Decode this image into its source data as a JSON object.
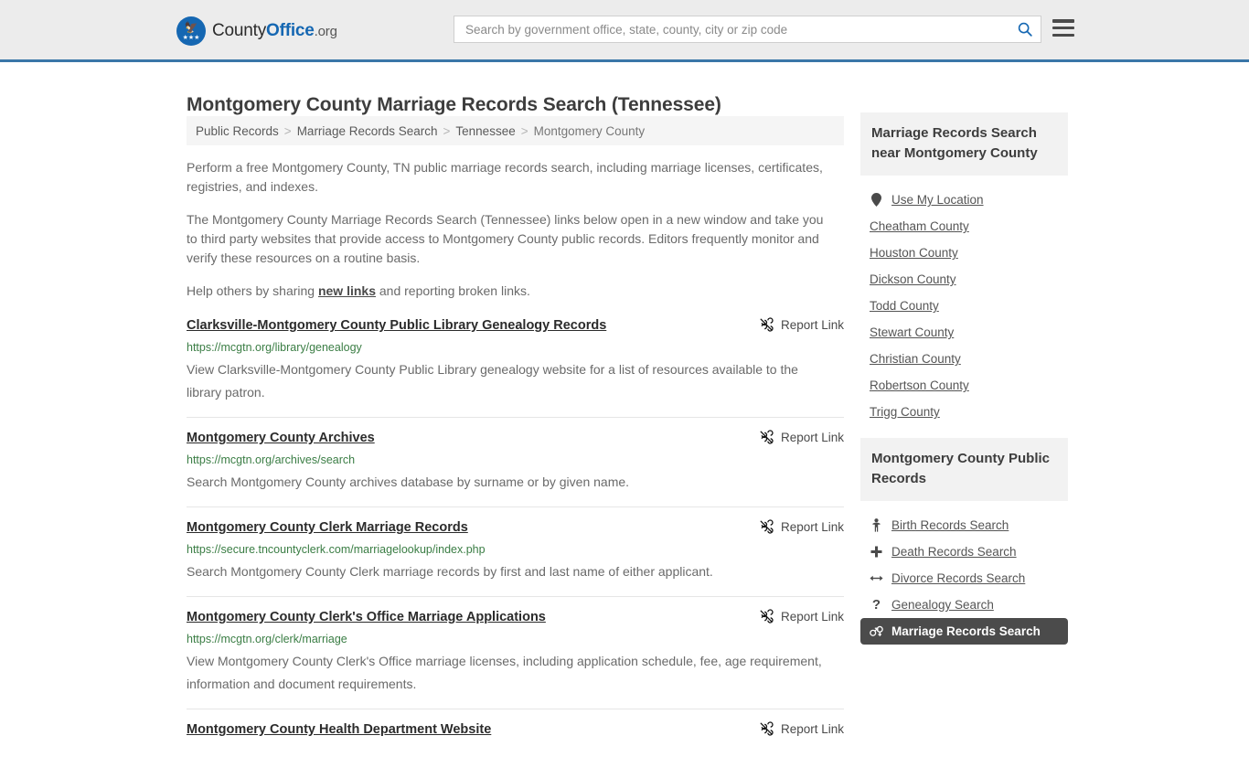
{
  "header": {
    "logo": {
      "part1": "County",
      "part2": "Office",
      "part3": ".org",
      "mark_icon": "eagle-stars-emblem"
    },
    "search": {
      "placeholder": "Search by government office, state, county, city or zip code",
      "value": "",
      "icon": "search-icon"
    },
    "menu_icon": "hamburger-menu-icon",
    "accent_color": "#1567b2",
    "border_color": "#3a76a8"
  },
  "page": {
    "title": "Montgomery County Marriage Records Search (Tennessee)"
  },
  "breadcrumb": {
    "items": [
      {
        "label": "Public Records",
        "current": false
      },
      {
        "label": "Marriage Records Search",
        "current": false
      },
      {
        "label": "Tennessee",
        "current": false
      },
      {
        "label": "Montgomery County",
        "current": true
      }
    ],
    "separator": ">"
  },
  "intro": {
    "paragraph1": "Perform a free Montgomery County, TN public marriage records search, including marriage licenses, certificates, registries, and indexes.",
    "paragraph2": "The Montgomery County Marriage Records Search (Tennessee) links below open in a new window and take you to third party websites that provide access to Montgomery County public records. Editors frequently monitor and verify these resources on a routine basis.",
    "help_prefix": "Help others by sharing ",
    "help_link": "new links",
    "help_suffix": " and reporting broken links."
  },
  "report_link_label": "Report Link",
  "report_link_icon": "broken-link-icon",
  "results": [
    {
      "title": "Clarksville-Montgomery County Public Library Genealogy Records",
      "url": "https://mcgtn.org/library/genealogy",
      "description": "View Clarksville-Montgomery County Public Library genealogy website for a list of resources available to the library patron."
    },
    {
      "title": "Montgomery County Archives",
      "url": "https://mcgtn.org/archives/search",
      "description": "Search Montgomery County archives database by surname or by given name."
    },
    {
      "title": "Montgomery County Clerk Marriage Records",
      "url": "https://secure.tncountyclerk.com/marriagelookup/index.php",
      "description": "Search Montgomery County Clerk marriage records by first and last name of either applicant."
    },
    {
      "title": "Montgomery County Clerk's Office Marriage Applications",
      "url": "https://mcgtn.org/clerk/marriage",
      "description": "View Montgomery County Clerk's Office marriage licenses, including application schedule, fee, age requirement, information and document requirements."
    },
    {
      "title": "Montgomery County Health Department Website",
      "url": "",
      "description": ""
    }
  ],
  "sidebar": {
    "nearby": {
      "heading": "Marriage Records Search near Montgomery County",
      "items": [
        {
          "label": "Use My Location",
          "icon": "map-pin-icon"
        },
        {
          "label": "Cheatham County",
          "icon": ""
        },
        {
          "label": "Houston County",
          "icon": ""
        },
        {
          "label": "Dickson County",
          "icon": ""
        },
        {
          "label": "Todd County",
          "icon": ""
        },
        {
          "label": "Stewart County",
          "icon": ""
        },
        {
          "label": "Christian County",
          "icon": ""
        },
        {
          "label": "Robertson County",
          "icon": ""
        },
        {
          "label": "Trigg County",
          "icon": ""
        }
      ]
    },
    "public_records": {
      "heading": "Montgomery County Public Records",
      "items": [
        {
          "label": "Birth Records Search",
          "icon": "baby-icon",
          "active": false
        },
        {
          "label": "Death Records Search",
          "icon": "cross-icon",
          "active": false
        },
        {
          "label": "Divorce Records Search",
          "icon": "left-right-arrow-icon",
          "active": false
        },
        {
          "label": "Genealogy Search",
          "icon": "question-mark-icon",
          "active": false
        },
        {
          "label": "Marriage Records Search",
          "icon": "male-female-icon",
          "active": true
        }
      ],
      "active_bg": "#4b4b4b"
    }
  }
}
